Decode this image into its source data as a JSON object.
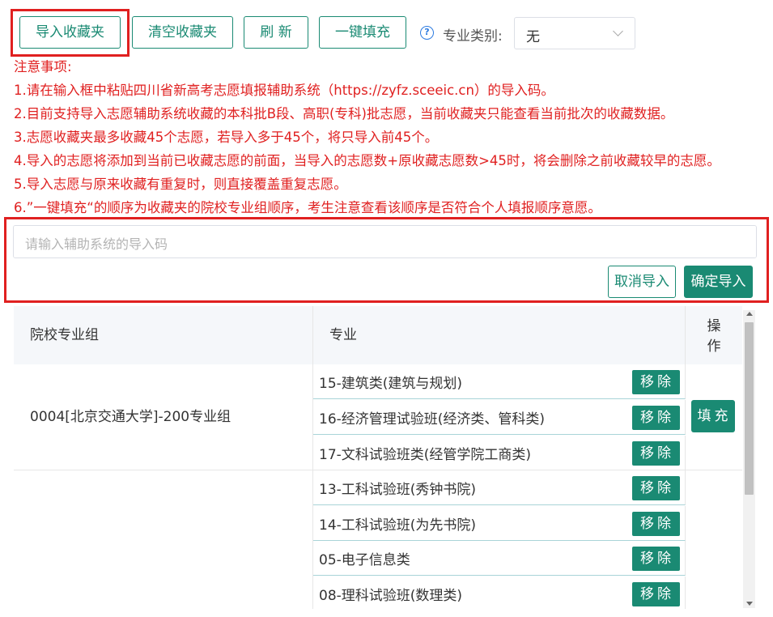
{
  "toolbar": {
    "import_label": "导入收藏夹",
    "clear_label": "清空收藏夹",
    "refresh_label": "刷 新",
    "autofill_label": "一键填充",
    "category_label": "专业类别:",
    "category_value": "无"
  },
  "notes": {
    "title": "注意事项:",
    "items": [
      "1.请在输入框中粘贴四川省新高考志愿填报辅助系统（https://zyfz.sceeic.cn）的导入码。",
      "2.目前支持导入志愿辅助系统收藏的本科批B段、高职(专科)批志愿，当前收藏夹只能查看当前批次的收藏数据。",
      "3.志愿收藏夹最多收藏45个志愿，若导入多于45个，将只导入前45个。",
      "4.导入的志愿将添加到当前已收藏志愿的前面，当导入的志愿数+原收藏志愿数>45时，将会删除之前收藏较早的志愿。",
      "5.导入志愿与原来收藏有重复时，则直接覆盖重复志愿。",
      "6.”一键填充“的顺序为收藏夹的院校专业组顺序，考生注意查看该顺序是否符合个人填报顺序意愿。"
    ]
  },
  "import": {
    "placeholder": "请输入辅助系统的导入码",
    "cancel_label": "取消导入",
    "confirm_label": "确定导入"
  },
  "table": {
    "headers": {
      "group": "院校专业组",
      "major": "专业",
      "ops": "操作"
    },
    "remove_label": "移除",
    "fill_label": "填充",
    "groups": [
      {
        "name": "0004[北京交通大学]-200专业组",
        "majors": [
          "15-建筑类(建筑与规划)",
          "16-经济管理试验班(经济类、管科类)",
          "17-文科试验班类(经管学院工商类)"
        ]
      },
      {
        "name": "",
        "majors": [
          "13-工科试验班(秀钟书院)",
          "14-工科试验班(为先书院)",
          "05-电子信息类",
          "08-理科试验班(数理类)"
        ]
      }
    ]
  }
}
